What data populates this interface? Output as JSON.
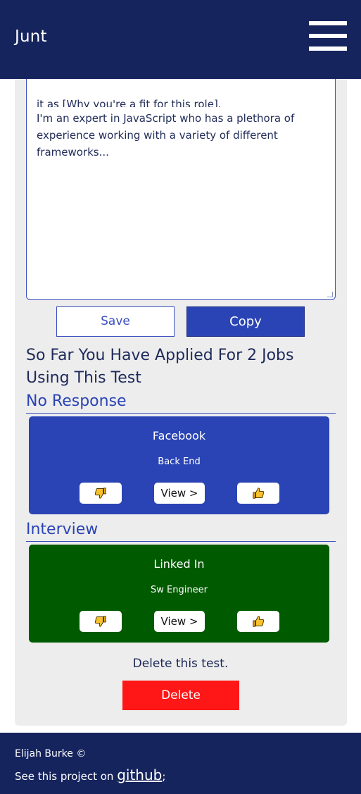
{
  "header": {
    "brand": "Junt"
  },
  "cover_letter": {
    "partial_top_line": "it as [Why you're a fit for this role].",
    "text": "I'm an expert in JavaScript who has a plethora of experience working with a variety of different frameworks..."
  },
  "actions": {
    "save_label": "Save",
    "copy_label": "Copy"
  },
  "applied_summary": "So Far You Have Applied For 2 Jobs Using This Test",
  "sections": [
    {
      "title": "No Response",
      "color": "#2a44b5",
      "job": {
        "company": "Facebook",
        "role": "Back End",
        "view_label": "View >"
      }
    },
    {
      "title": "Interview",
      "color": "#005a00",
      "job": {
        "company": "Linked In",
        "role": "Sw Engineer",
        "view_label": "View >"
      }
    }
  ],
  "delete": {
    "label": "Delete this test.",
    "button": "Delete"
  },
  "footer": {
    "author": "Elijah Burke ©",
    "see_prefix": "See this project on",
    "link_text": "github",
    "suffix": ";"
  },
  "icons": {
    "thumbs_down": "thumbs-down-icon",
    "thumbs_up": "thumbs-up-icon",
    "menu": "hamburger-menu-icon"
  }
}
